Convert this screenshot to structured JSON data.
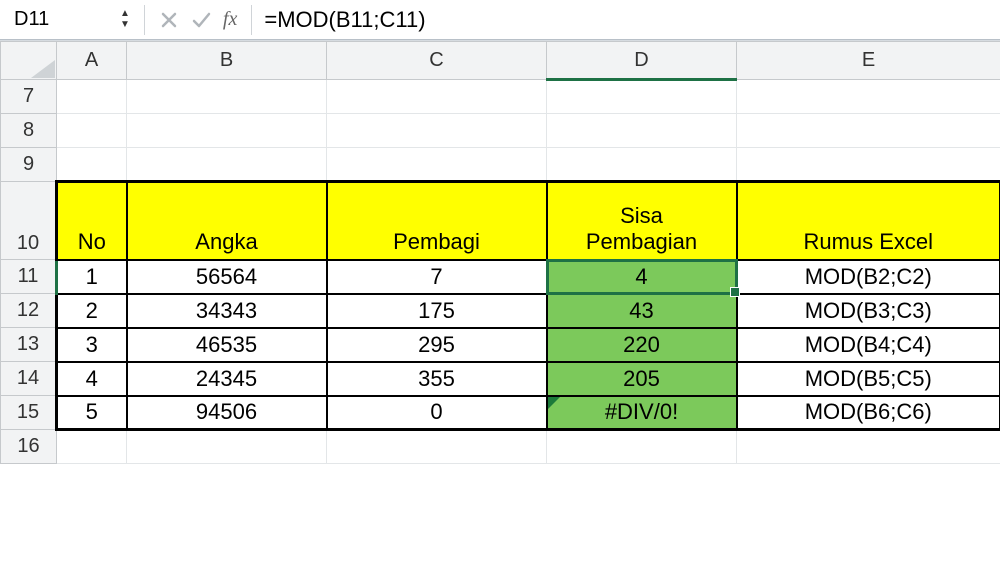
{
  "nameBox": "D11",
  "formula": "=MOD(B11;C11)",
  "columns": [
    "A",
    "B",
    "C",
    "D",
    "E"
  ],
  "visibleRows": [
    "7",
    "8",
    "9",
    "10",
    "11",
    "12",
    "13",
    "14",
    "15",
    "16"
  ],
  "selectedCell": "D11",
  "selectedCol": "D",
  "selectedRow": "11",
  "table": {
    "headers": {
      "no": "No",
      "angka": "Angka",
      "pembagi": "Pembagi",
      "sisa1": "Sisa",
      "sisa2": "Pembagian",
      "rumus": "Rumus Excel"
    },
    "rows": [
      {
        "no": "1",
        "angka": "56564",
        "pembagi": "7",
        "sisa": "4",
        "rumus": "MOD(B2;C2)"
      },
      {
        "no": "2",
        "angka": "34343",
        "pembagi": "175",
        "sisa": "43",
        "rumus": "MOD(B3;C3)"
      },
      {
        "no": "3",
        "angka": "46535",
        "pembagi": "295",
        "sisa": "220",
        "rumus": "MOD(B4;C4)"
      },
      {
        "no": "4",
        "angka": "24345",
        "pembagi": "355",
        "sisa": "205",
        "rumus": "MOD(B5;C5)"
      },
      {
        "no": "5",
        "angka": "94506",
        "pembagi": "0",
        "sisa": "#DIV/0!",
        "rumus": "MOD(B6;C6)"
      }
    ]
  },
  "chart_data": {
    "type": "table",
    "title": "MOD function example",
    "columns": [
      "No",
      "Angka",
      "Pembagi",
      "Sisa Pembagian",
      "Rumus Excel"
    ],
    "data": [
      [
        1,
        56564,
        7,
        4,
        "MOD(B2;C2)"
      ],
      [
        2,
        34343,
        175,
        43,
        "MOD(B3;C3)"
      ],
      [
        3,
        46535,
        295,
        220,
        "MOD(B4;C4)"
      ],
      [
        4,
        24345,
        355,
        205,
        "MOD(B5;C5)"
      ],
      [
        5,
        94506,
        0,
        "#DIV/0!",
        "MOD(B6;C6)"
      ]
    ]
  }
}
